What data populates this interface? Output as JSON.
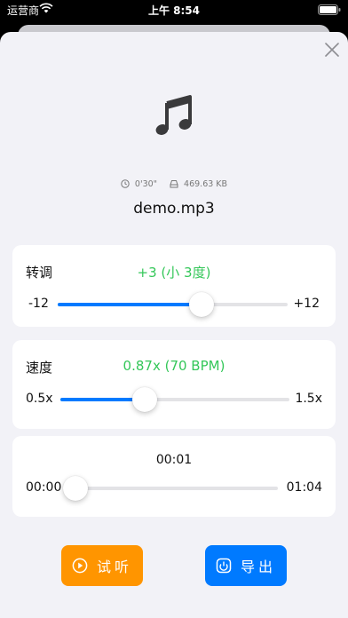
{
  "status_bar": {
    "carrier": "运营商",
    "time": "上午 8:54"
  },
  "sheet": {
    "file_duration": "0'30\"",
    "file_size": "469.63 KB",
    "file_name": "demo.mp3"
  },
  "pitch": {
    "label": "转调",
    "value": "+3 (小 3度)",
    "min_label": "-12",
    "max_label": "+12",
    "min": -12,
    "max": 12,
    "current": 3
  },
  "speed": {
    "label": "速度",
    "value": "0.87x (70 BPM)",
    "min_label": "0.5x",
    "max_label": "1.5x",
    "min": 0.5,
    "max": 1.5,
    "current": 0.87
  },
  "progress": {
    "current_time": "00:01",
    "start_label": "00:00",
    "end_label": "01:04",
    "fraction": 0.016
  },
  "buttons": {
    "preview_label": "试听",
    "export_label": "导出"
  },
  "colors": {
    "accent_blue": "#007aff",
    "accent_orange": "#ff9500",
    "value_green": "#34c759"
  },
  "icons": {
    "close": "close-icon",
    "music": "music-note-icon",
    "clock": "clock-icon",
    "storage": "storage-icon",
    "play": "play-circle-icon",
    "export": "export-icon"
  }
}
